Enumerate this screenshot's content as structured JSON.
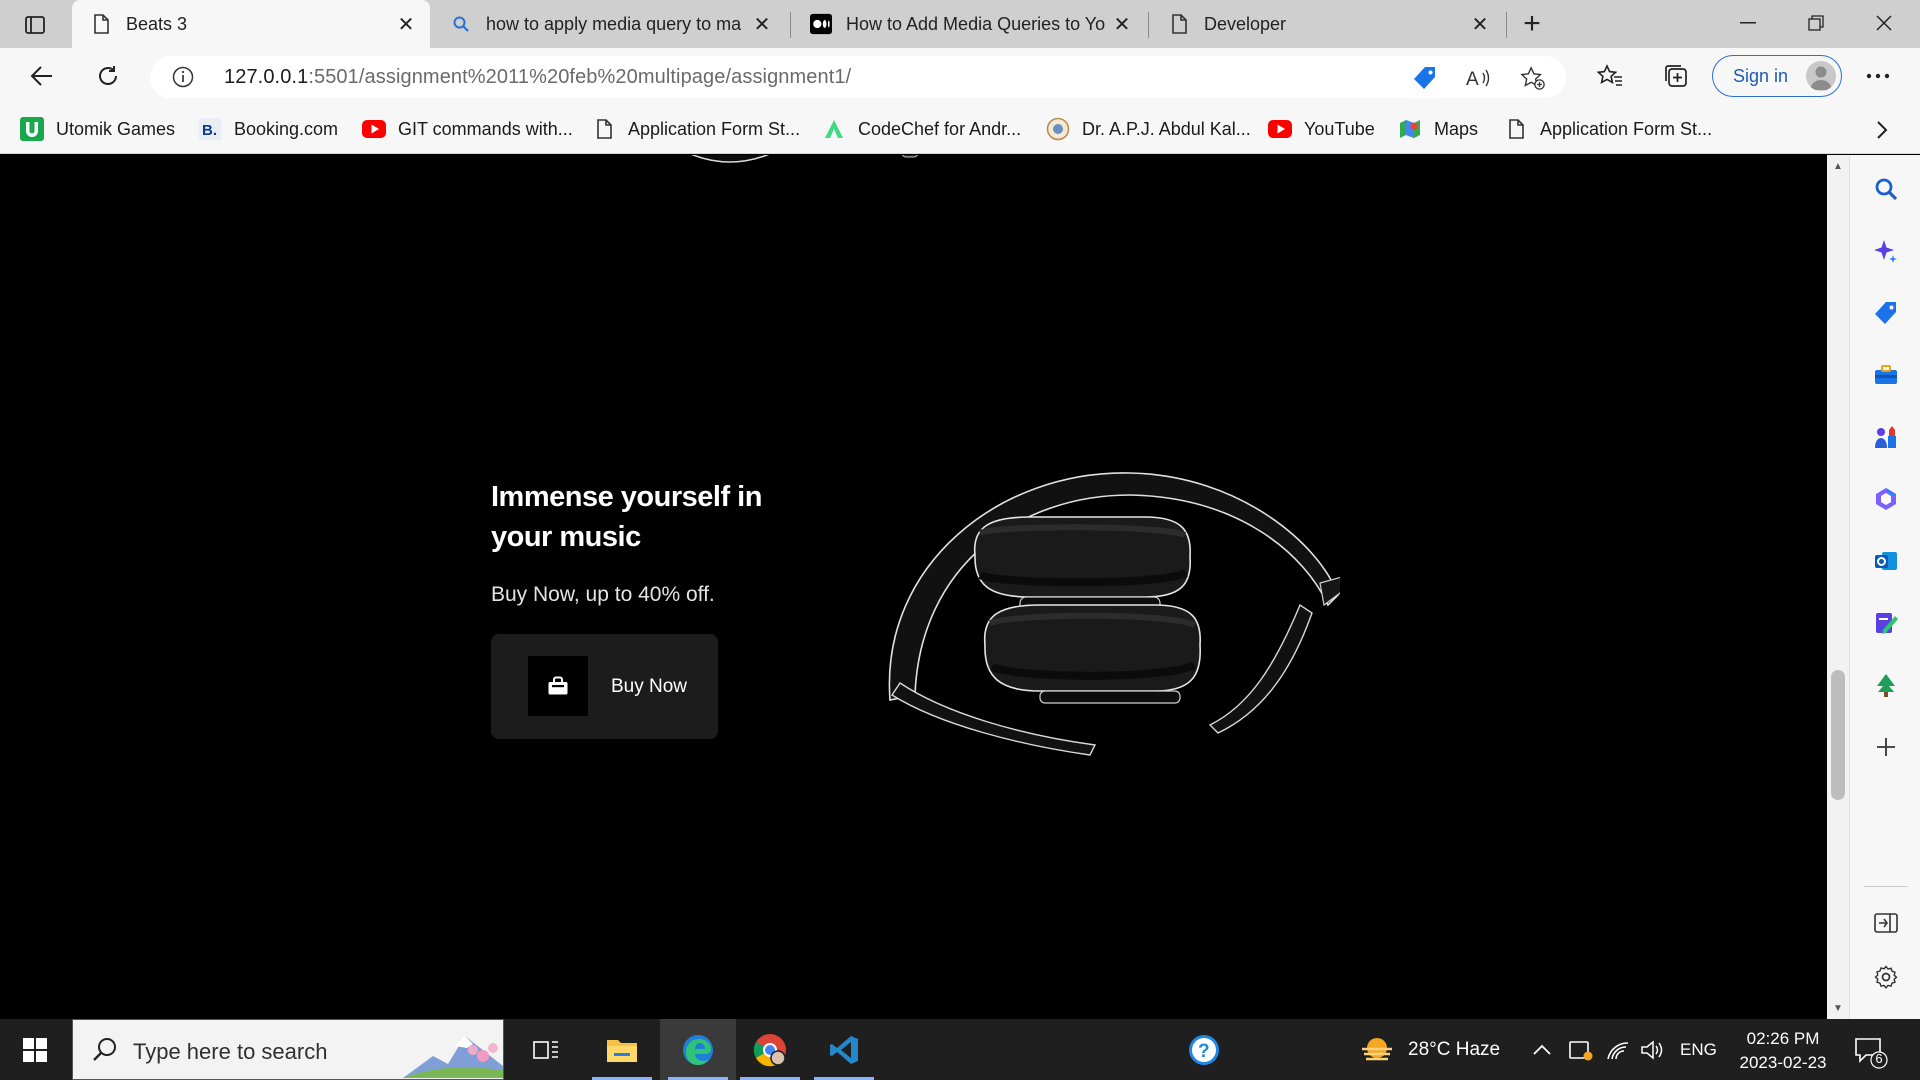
{
  "browser": {
    "tabs": [
      {
        "title": "Beats 3",
        "active": true
      },
      {
        "title": "how to apply media query to ma",
        "active": false
      },
      {
        "title": "How to Add Media Queries to Yo",
        "active": false
      },
      {
        "title": "Developer",
        "active": false
      }
    ],
    "url_host": "127.0.0.1",
    "url_path": ":5501/assignment%2011%20feb%20multipage/assignment1/",
    "signin_label": "Sign in",
    "bookmarks": [
      {
        "label": "Utomik Games",
        "icon": "utomik-icon"
      },
      {
        "label": "Booking.com",
        "icon": "booking-icon"
      },
      {
        "label": "GIT commands with...",
        "icon": "youtube-icon"
      },
      {
        "label": "Application Form St...",
        "icon": "page-icon"
      },
      {
        "label": "CodeChef for Andr...",
        "icon": "codechef-icon"
      },
      {
        "label": "Dr. A.P.J. Abdul Kal...",
        "icon": "emblem-icon"
      },
      {
        "label": "YouTube",
        "icon": "youtube-icon"
      },
      {
        "label": "Maps",
        "icon": "maps-icon"
      },
      {
        "label": "Application Form St...",
        "icon": "page-icon"
      }
    ]
  },
  "page": {
    "hero_title": "Immense yourself in your music",
    "hero_subtitle": "Buy Now, up to 40% off.",
    "buy_button_label": "Buy Now"
  },
  "taskbar": {
    "search_placeholder": "Type here to search",
    "weather": "28°C  Haze",
    "language": "ENG",
    "time": "02:26 PM",
    "date": "2023-02-23",
    "notification_count": "6"
  },
  "colors": {
    "page_background": "#000000",
    "button_background": "#1c1c1c",
    "signin_accent": "#2b6fd6"
  }
}
